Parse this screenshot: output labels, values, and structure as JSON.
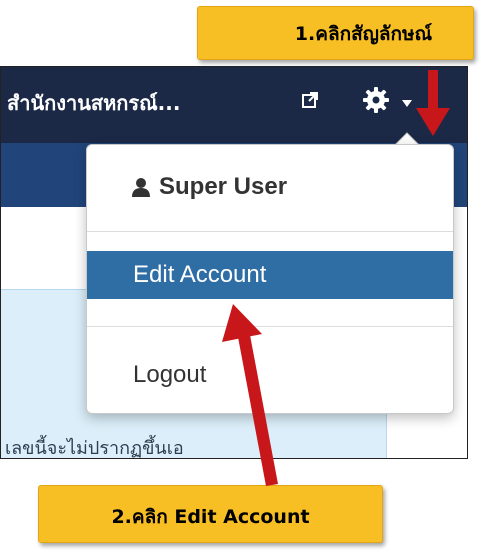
{
  "callouts": {
    "step1": "1.คลิกสัญลักษณ์",
    "step2": "2.คลิก Edit Account"
  },
  "header": {
    "site_title": "สำนักงานสหกรณ์...",
    "external_link_icon": "external-link-icon",
    "gear_icon": "gear-icon",
    "caret_icon": "caret-down-icon"
  },
  "dropdown": {
    "user_icon": "user-icon",
    "user_name": "Super User",
    "edit_account": "Edit Account",
    "logout": "Logout"
  },
  "content": {
    "notice_text": "เลขนี้จะไม่ปรากฏขึ้นเอ"
  },
  "colors": {
    "topbar": "#1b2947",
    "navbar": "#21457a",
    "menu_active": "#2f6ea5",
    "info_box": "#dbeef9",
    "callout": "#f8bf25",
    "arrow": "#c8171a"
  }
}
